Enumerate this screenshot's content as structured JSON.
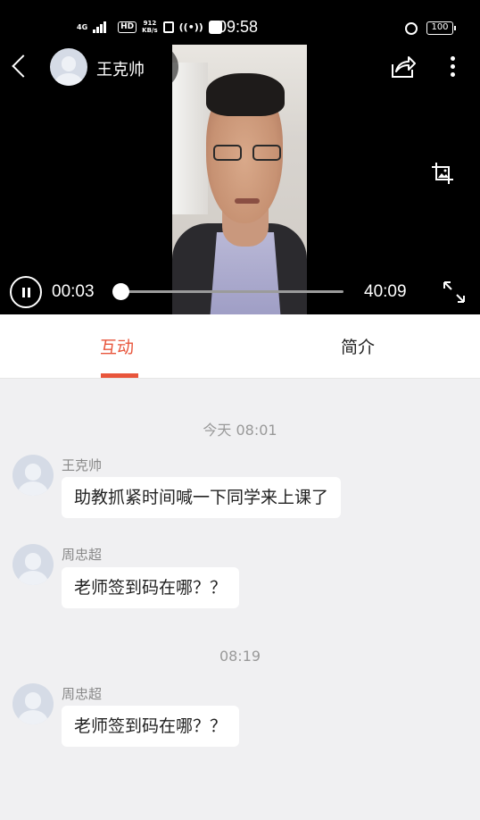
{
  "status_bar": {
    "network": "4G",
    "hd": "HD",
    "speed_value": "912",
    "speed_unit": "KB/s",
    "time": "09:58",
    "battery": "100"
  },
  "header": {
    "host_name": "王克帅"
  },
  "player": {
    "current_time": "00:03",
    "total_time": "40:09",
    "progress": 0.001,
    "state": "playing"
  },
  "tabs": [
    {
      "label": "互动",
      "active": true
    },
    {
      "label": "简介",
      "active": false
    }
  ],
  "chat": [
    {
      "type": "time",
      "text": "今天 08:01"
    },
    {
      "type": "message",
      "sender": "王克帅",
      "text": "助教抓紧时间喊一下同学来上课了"
    },
    {
      "type": "message",
      "sender": "周忠超",
      "text": "老师签到码在哪？？"
    },
    {
      "type": "time",
      "text": "08:19"
    },
    {
      "type": "message",
      "sender": "周忠超",
      "text": "老师签到码在哪？？"
    }
  ],
  "colors": {
    "accent": "#e8553b",
    "chat_background": "#f0f0f2",
    "video_background": "#000000"
  },
  "icons": [
    "back-icon",
    "share-icon",
    "more-icon",
    "screenshot-crop-icon",
    "pause-icon",
    "fullscreen-icon",
    "avatar-placeholder-icon",
    "alarm-icon",
    "battery-icon",
    "signal-icon"
  ]
}
